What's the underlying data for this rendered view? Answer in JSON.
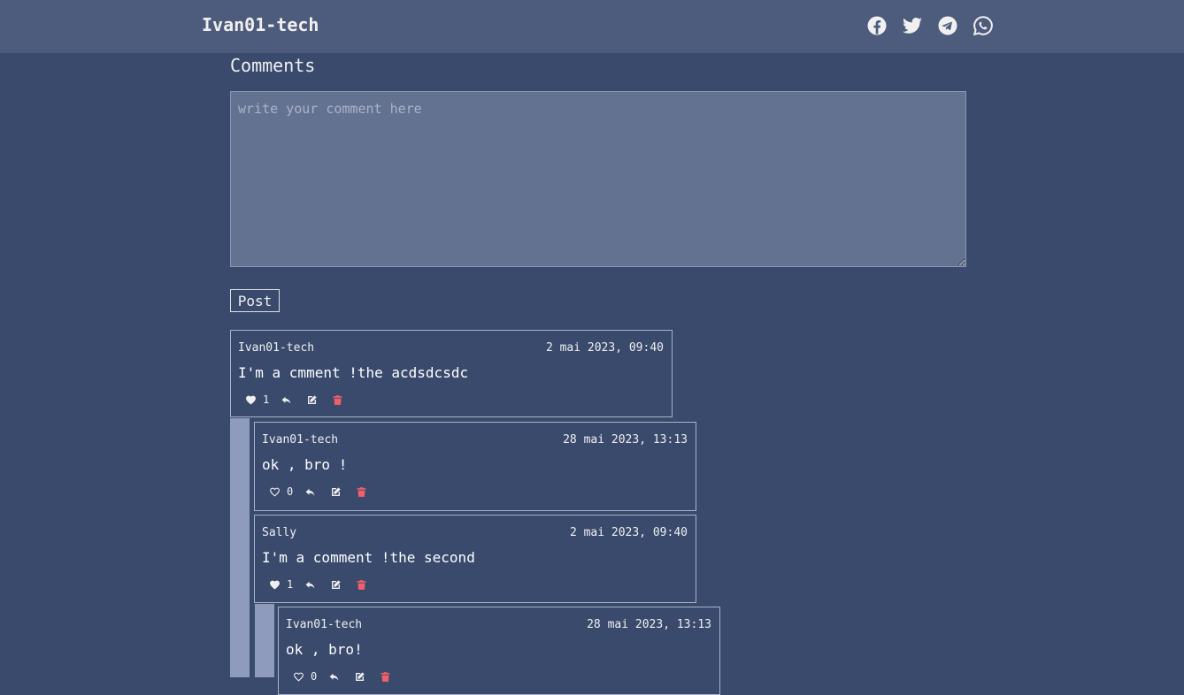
{
  "nav": {
    "brand": "Ivan01-tech",
    "social_icons": [
      "facebook-icon",
      "twitter-icon",
      "telegram-icon",
      "whatsapp-icon"
    ]
  },
  "comments_section": {
    "heading": "Comments",
    "input_placeholder": "write your comment here",
    "input_value": "",
    "post_label": "Post"
  },
  "comments": [
    {
      "author": "Ivan01-tech",
      "date": "2 mai 2023, 09:40",
      "text": "I'm a cmment !the acdsdcsdc",
      "likes": "1",
      "liked": true
    },
    {
      "author": "Ivan01-tech",
      "date": "28 mai 2023, 13:13",
      "text": "ok , bro !",
      "likes": "0",
      "liked": false
    },
    {
      "author": "Sally",
      "date": "2 mai 2023, 09:40",
      "text": "I'm a comment !the second",
      "likes": "1",
      "liked": true
    },
    {
      "author": "Ivan01-tech",
      "date": "28 mai 2023, 13:13",
      "text": "ok , bro!",
      "likes": "0",
      "liked": false
    }
  ],
  "colors": {
    "background": "#394a6d",
    "topbar": "#4d5b7c",
    "textarea": "#647291",
    "thread_bar": "#8f9bbc",
    "delete": "#f0606a"
  }
}
